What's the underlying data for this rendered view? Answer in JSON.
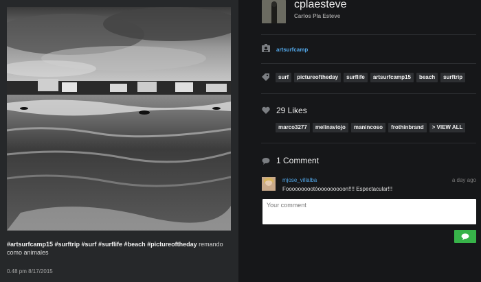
{
  "post": {
    "caption_tags": "#artsurfcamp15 #surftrip #surf #surflife #beach #pictureoftheday",
    "caption_text": "remando como animales",
    "date": "0.48 pm 8/17/2015",
    "photo_icon": "surf-photo"
  },
  "user": {
    "username": "cplaesteve",
    "full_name": "Carlos Pla Esteve"
  },
  "location": {
    "icon": "location-icon",
    "name": "artsurfcamp"
  },
  "tags": {
    "icon": "tag-icon",
    "items": [
      "surf",
      "pictureoftheday",
      "surflife",
      "artsurfcamp15",
      "beach",
      "surftrip"
    ]
  },
  "likes": {
    "icon": "heart-icon",
    "label": "29 Likes",
    "users": [
      "marco3277",
      "melinaviojo",
      "manincoso",
      "frothinbrand",
      "> VIEW ALL"
    ]
  },
  "comments": {
    "icon": "comment-icon",
    "label": "1 Comment",
    "items": [
      {
        "user": "mjose_villalba",
        "time": "a day ago",
        "text": "Foooooooootóooooooooon!!!! Espectacular!!!"
      }
    ],
    "input_placeholder": "Your comment",
    "send_icon": "speech-bubble-icon"
  },
  "colors": {
    "link": "#52a7e8",
    "send_button": "#37b349",
    "panel_left": "#26282a",
    "panel_right": "#161719"
  }
}
